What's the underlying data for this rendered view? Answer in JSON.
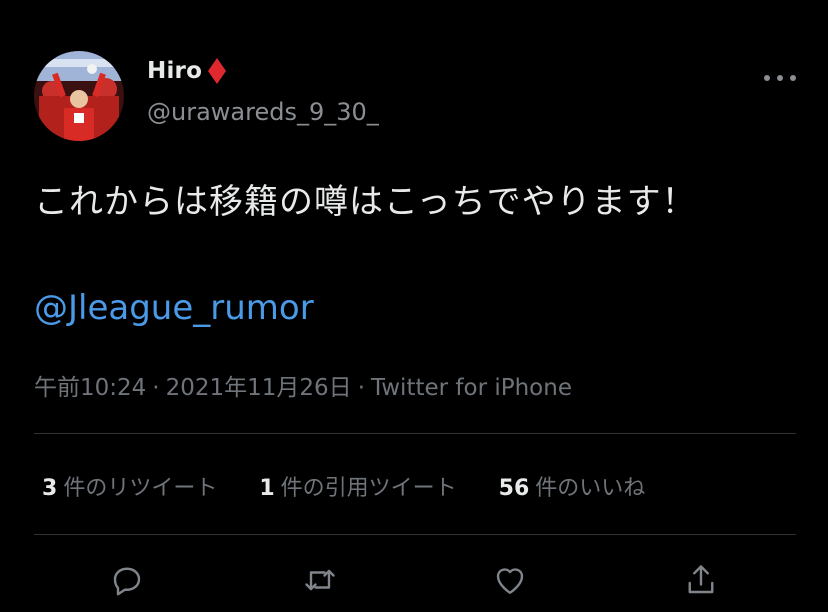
{
  "user": {
    "display_name": "Hiro",
    "badge_icon": "red-diamond-icon",
    "handle": "@urawareds_9_30_",
    "avatar": "profile-photo"
  },
  "tweet": {
    "text": "これからは移籍の噂はこっちでやります！",
    "mention": "@Jleague_rumor",
    "time": "午前10:24",
    "date": "2021年11月26日",
    "source": "Twitter for iPhone",
    "separator": "·"
  },
  "stats": {
    "retweets_count": "3",
    "retweets_label": "件のリツイート",
    "quotes_count": "1",
    "quotes_label": "件の引用ツイート",
    "likes_count": "56",
    "likes_label": "件のいいね"
  },
  "actions": [
    "reply-icon",
    "retweet-icon",
    "like-icon",
    "share-icon"
  ],
  "colors": {
    "background": "#000000",
    "text": "#e7e9ea",
    "secondary": "#6f747a",
    "link": "#4a9ae8",
    "badge": "#e0282f",
    "divider": "#2f3336"
  }
}
